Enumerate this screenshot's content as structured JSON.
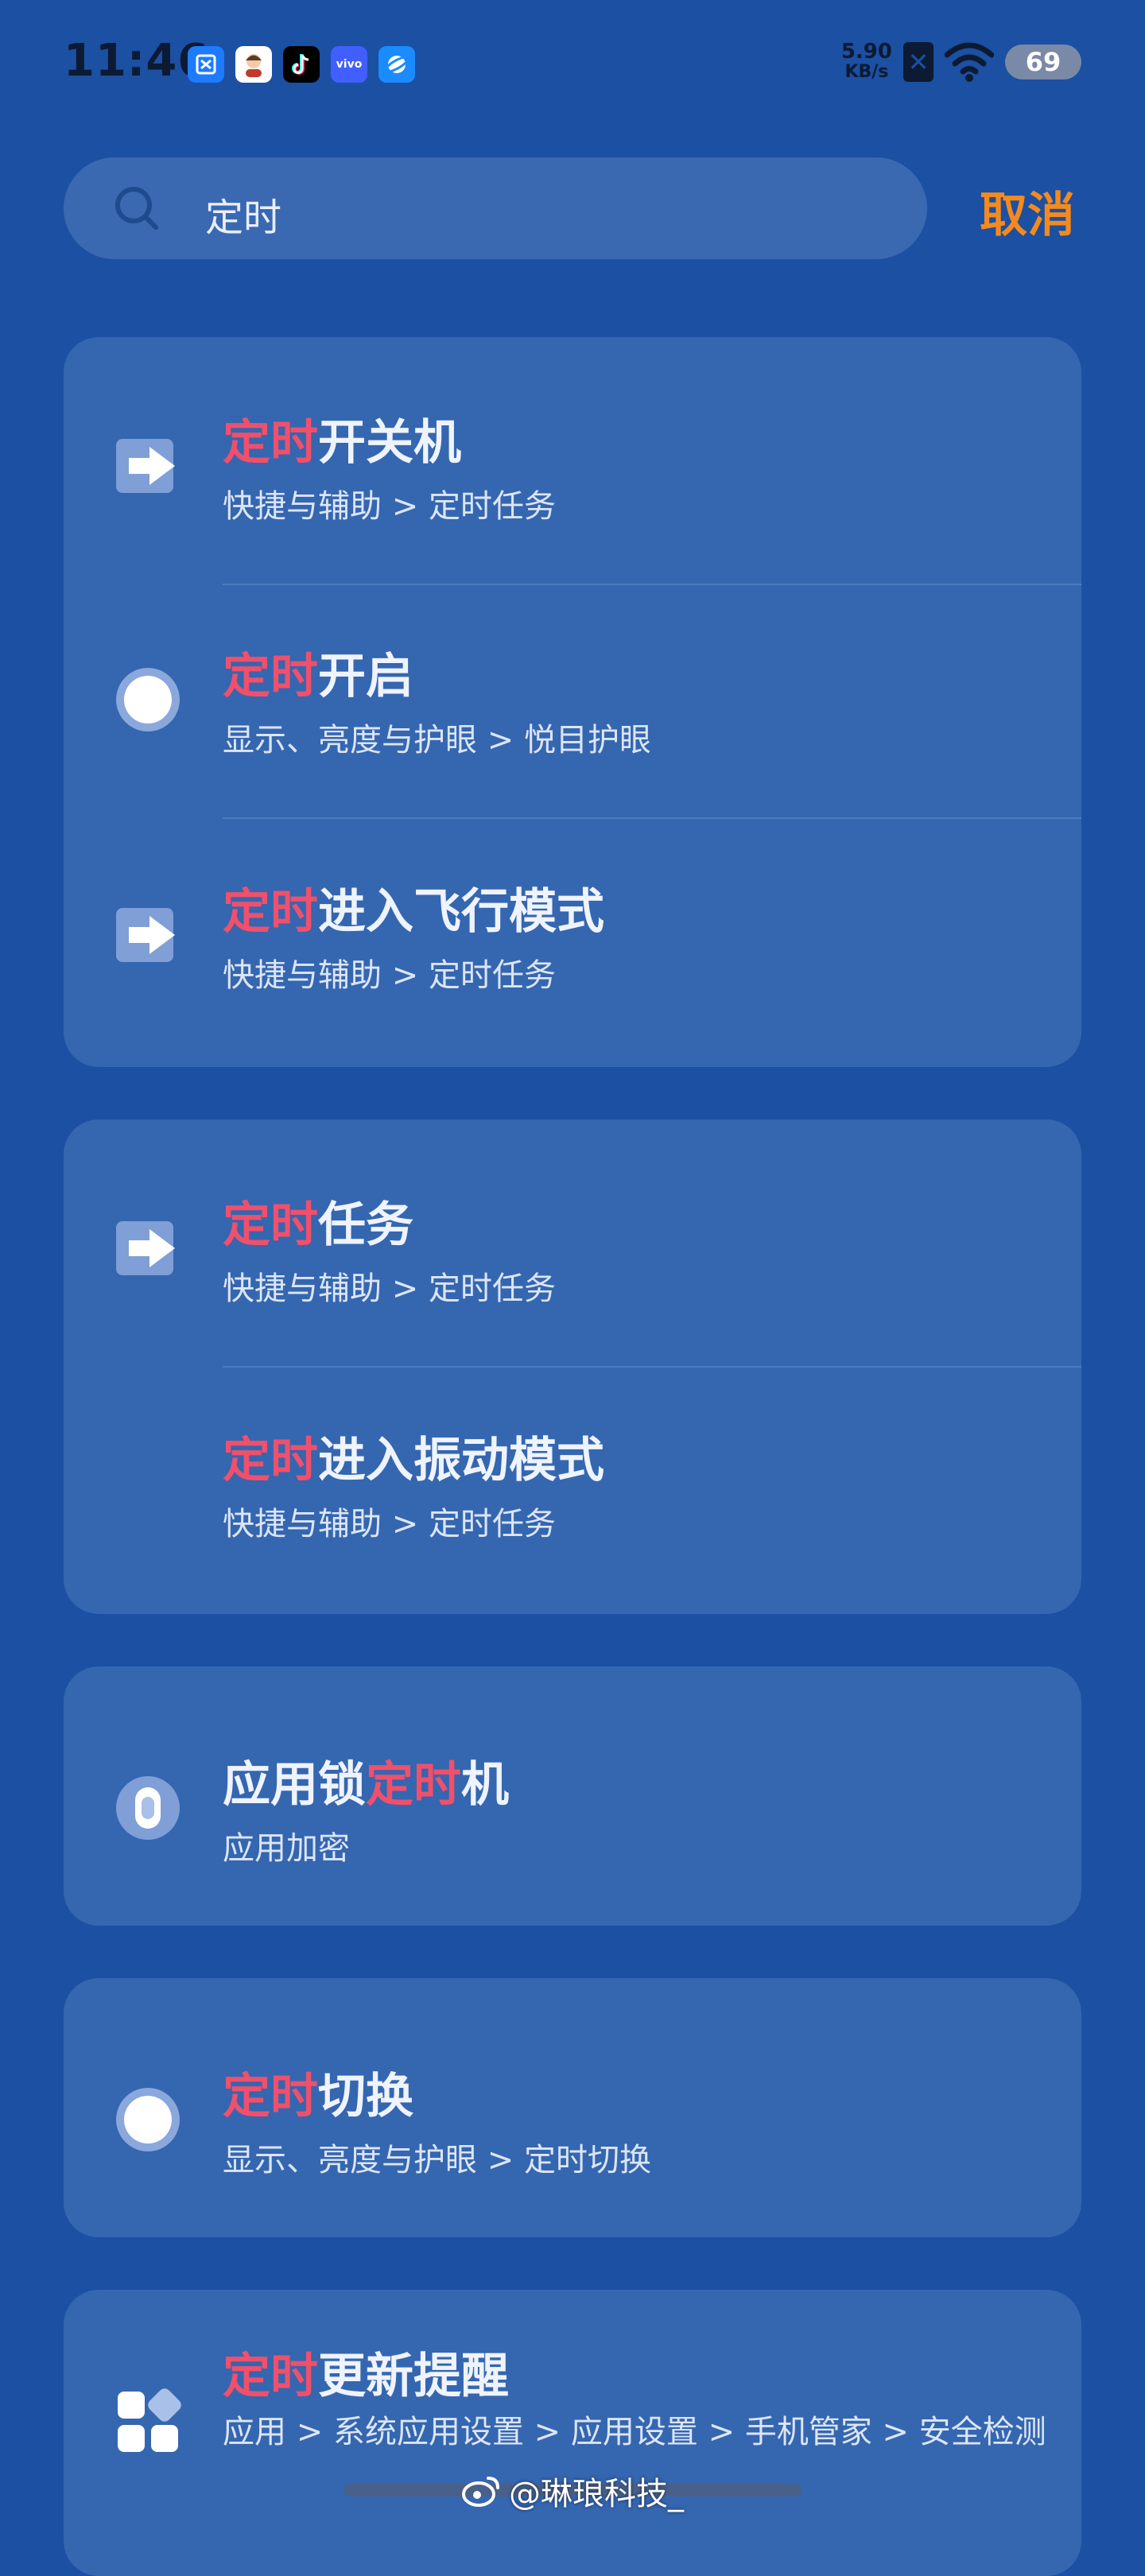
{
  "status_bar": {
    "time": "11:46",
    "net_speed_value": "5.90",
    "net_speed_unit": "KB/s",
    "battery": "69"
  },
  "search": {
    "query": "定时",
    "cancel_label": "取消"
  },
  "cards": [
    {
      "items": [
        {
          "title_pre": "",
          "title_hl": "定时",
          "title_post": "开关机",
          "subtitle": "快捷与辅助 > 定时任务",
          "icon": "arrow-right-icon"
        },
        {
          "title_pre": "",
          "title_hl": "定时",
          "title_post": "开启",
          "subtitle": "显示、亮度与护眼 > 悦目护眼",
          "icon": "circle-icon"
        },
        {
          "title_pre": "",
          "title_hl": "定时",
          "title_post": "进入飞行模式",
          "subtitle": "快捷与辅助 > 定时任务",
          "icon": "arrow-right-icon"
        }
      ]
    },
    {
      "items": [
        {
          "title_pre": "",
          "title_hl": "定时",
          "title_post": "任务",
          "subtitle": "快捷与辅助 > 定时任务",
          "icon": "arrow-right-icon"
        },
        {
          "title_pre": "",
          "title_hl": "定时",
          "title_post": "进入振动模式",
          "subtitle": "快捷与辅助 > 定时任务",
          "icon": ""
        }
      ]
    },
    {
      "items": [
        {
          "title_pre": "应用锁",
          "title_hl": "定时",
          "title_post": "机",
          "subtitle": "应用加密",
          "icon": "app-lock-icon"
        }
      ]
    },
    {
      "items": [
        {
          "title_pre": "",
          "title_hl": "定时",
          "title_post": "切换",
          "subtitle": "显示、亮度与护眼 > 定时切换",
          "icon": "circle-icon"
        }
      ]
    },
    {
      "items": [
        {
          "title_pre": "",
          "title_hl": "定时",
          "title_post": "更新提醒",
          "subtitle": "应用 > 系统应用设置 > 应用设置 > 手机管家 > 安全检测",
          "icon": "apps-grid-icon"
        }
      ]
    }
  ],
  "watermark": "@琳琅科技_",
  "colors": {
    "background": "#1b50a2",
    "card": "#3566b0",
    "highlight": "#f0506b",
    "cancel": "#f48a1e"
  }
}
